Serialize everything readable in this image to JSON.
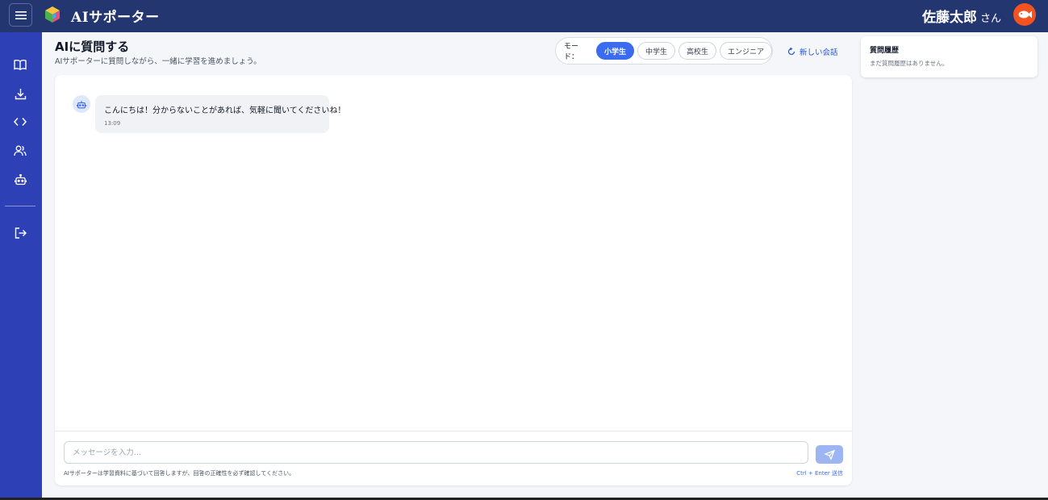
{
  "topbar": {
    "app_title": "AIサポーター",
    "user_name": "佐藤太郎",
    "user_honorific": "さん",
    "bg_color": "#243670"
  },
  "sidebar": {
    "items": [
      {
        "icon": "book-icon"
      },
      {
        "icon": "download-icon"
      },
      {
        "icon": "code-icon"
      },
      {
        "icon": "users-icon"
      },
      {
        "icon": "robot-icon"
      },
      {
        "icon": "logout-icon"
      }
    ],
    "bg_color": "#2e40b5"
  },
  "header": {
    "title": "AIに質問する",
    "subtitle": "AIサポーターに質問しながら、一緒に学習を進めましょう。"
  },
  "mode": {
    "label": "モード：",
    "options": [
      "小学生",
      "中学生",
      "高校生",
      "エンジニア"
    ],
    "selected": "小学生"
  },
  "new_chat_label": "新しい会話",
  "history": {
    "title": "質問履歴",
    "empty_text": "まだ質問履歴はありません。"
  },
  "chat": {
    "messages": [
      {
        "sender": "bot",
        "text": "こんにちは！分からないことがあれば、気軽に聞いてくださいね！",
        "time": "13:09"
      }
    ],
    "input_placeholder": "メッセージを入力...",
    "disclaimer": "AIサポーターは学習資料に基づいて回答しますが、回答の正確性を必ず確認してください。",
    "shortcut_hint": "Ctrl + Enter 送信"
  },
  "colors": {
    "accent": "#3b6cf0",
    "send_button": "#9db5f3",
    "avatar": "#f4521e"
  }
}
